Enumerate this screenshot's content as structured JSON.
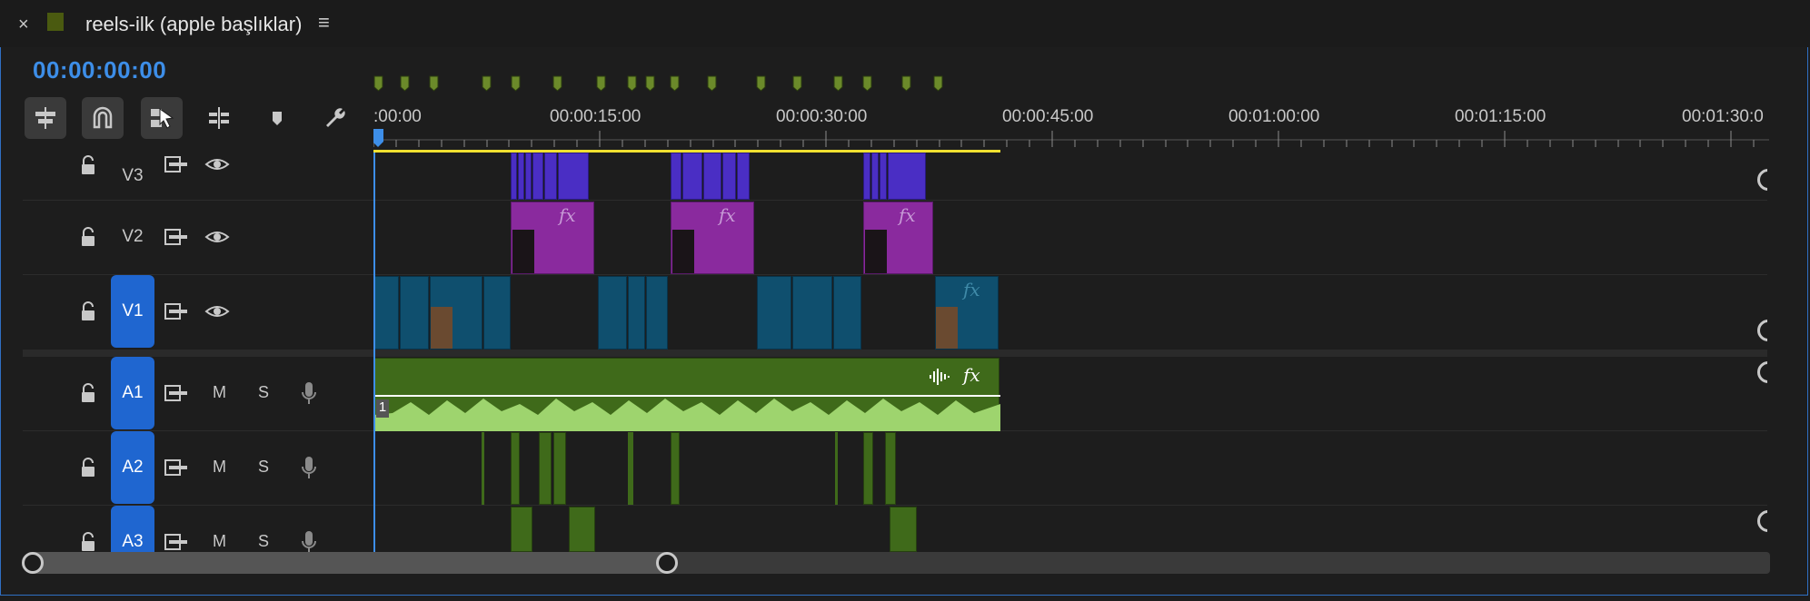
{
  "window": {
    "close_glyph": "×",
    "title": "reels-ilk (apple başlıklar)",
    "menu_glyph": "≡",
    "swatch_color": "#4a5a10"
  },
  "playhead_timecode": "00:00:00:00",
  "toolbar": {
    "tools": [
      {
        "icon": "insert-nest-icon",
        "active": true
      },
      {
        "icon": "snap-magnet-icon",
        "active": true
      },
      {
        "icon": "linked-selection-icon",
        "active": true
      },
      {
        "icon": "add-edit-icon",
        "active": false
      },
      {
        "icon": "add-marker-icon",
        "active": false
      },
      {
        "icon": "wrench-icon",
        "active": false
      }
    ]
  },
  "ruler": {
    "labels": [
      ":00:00",
      "00:00:15:00",
      "00:00:30:00",
      "00:00:45:00",
      "00:01:00:00",
      "00:01:15:00",
      "00:01:30:0"
    ],
    "marker_color": "#6b8a2a",
    "work_area_color": "#f0e030"
  },
  "tracks": {
    "video": [
      {
        "name": "V3",
        "selected": false
      },
      {
        "name": "V2",
        "selected": false
      },
      {
        "name": "V1",
        "selected": true
      }
    ],
    "audio": [
      {
        "name": "A1",
        "selected": true,
        "mute": "M",
        "solo": "S",
        "clip_channel_label": "1"
      },
      {
        "name": "A2",
        "selected": true,
        "mute": "M",
        "solo": "S"
      },
      {
        "name": "A3",
        "selected": true,
        "mute": "M",
        "solo": "S"
      }
    ]
  },
  "clips": {
    "fx_label": "fx",
    "colors": {
      "title": "#4a2ec4",
      "graphic": "#8a2a9e",
      "video": "#0f4f6e",
      "audio": "#3f6a1a",
      "waveform": "#9ed46e",
      "accent": "#1f66d0"
    }
  }
}
